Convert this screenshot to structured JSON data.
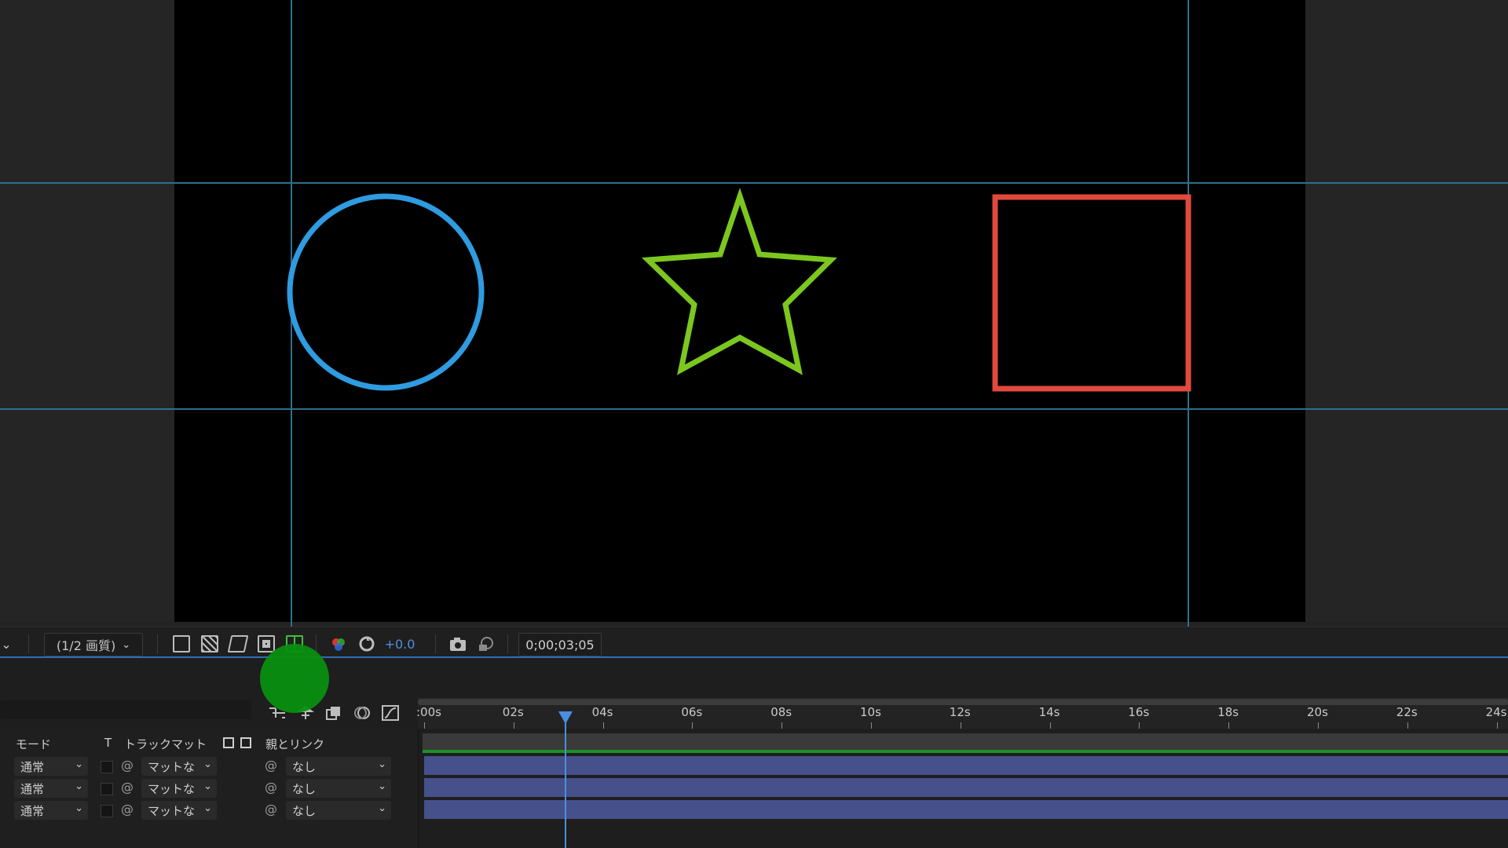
{
  "viewer": {
    "colors": {
      "circle": "#2f9be0",
      "star": "#7cc71f",
      "square": "#e04a3c",
      "guide": "#2f6f8e"
    }
  },
  "footer": {
    "left_dropdown_chevron": "⌄",
    "resolution": "(1/2 画質)",
    "icons": [
      "fast-preview-icon",
      "transparency-grid-icon",
      "mask-path-icon",
      "region-of-interest-icon",
      "grid-guides-icon",
      "color-channel-icon",
      "reset-exposure-icon"
    ],
    "exposure_value": "+0.0",
    "timecode": "0;00;03;05"
  },
  "timeline": {
    "columns": {
      "mode": "モード",
      "t": "T",
      "track_matte": "トラックマット",
      "parent": "親とリンク"
    },
    "layers": [
      {
        "mode": "通常",
        "matte": "マットな",
        "parent": "なし"
      },
      {
        "mode": "通常",
        "matte": "マットな",
        "parent": "なし"
      },
      {
        "mode": "通常",
        "matte": "マットな",
        "parent": "なし"
      }
    ],
    "ruler_labels": [
      ":00s",
      "02s",
      "04s",
      "06s",
      "08s",
      "10s",
      "12s",
      "14s",
      "16s",
      "18s",
      "20s",
      "22s",
      "24s"
    ],
    "current_time_seconds": 3.17
  }
}
